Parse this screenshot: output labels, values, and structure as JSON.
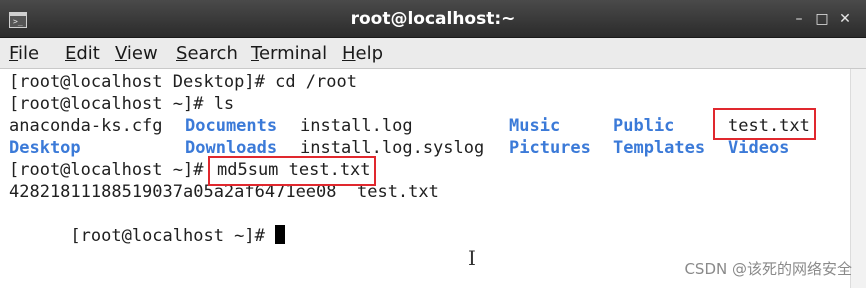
{
  "window": {
    "title": "root@localhost:~",
    "icon": "terminal-icon",
    "controls": {
      "minimize": "–",
      "maximize": "□",
      "close": "✕"
    }
  },
  "menubar": {
    "items": [
      {
        "key": "F",
        "rest": "ile"
      },
      {
        "key": "E",
        "rest": "dit"
      },
      {
        "key": "V",
        "rest": "iew"
      },
      {
        "key": "S",
        "rest": "earch"
      },
      {
        "key": "T",
        "rest": "erminal"
      },
      {
        "key": "H",
        "rest": "elp"
      }
    ]
  },
  "terminal": {
    "line1": "[root@localhost Desktop]# cd /root",
    "line2": "[root@localhost ~]# ls",
    "ls_row1": {
      "c1": "anaconda-ks.cfg",
      "c2": "Documents",
      "c3": "install.log",
      "c4": "Music",
      "c5": "Public",
      "c6": "test.txt"
    },
    "ls_row2": {
      "c1": "Desktop",
      "c2": "Downloads",
      "c3": "install.log.syslog",
      "c4": "Pictures",
      "c5": "Templates",
      "c6": "Videos"
    },
    "line5_prompt": "[root@localhost ~]#",
    "line5_cmd": "md5sum test.txt",
    "line6": "42821811188519037a05a2af6471ee08  test.txt",
    "line7_prompt": "[root@localhost ~]#"
  },
  "colors": {
    "directory": "#3b7ad8",
    "highlight": "#e0282e"
  },
  "watermark": "CSDN @该死的网络安全"
}
